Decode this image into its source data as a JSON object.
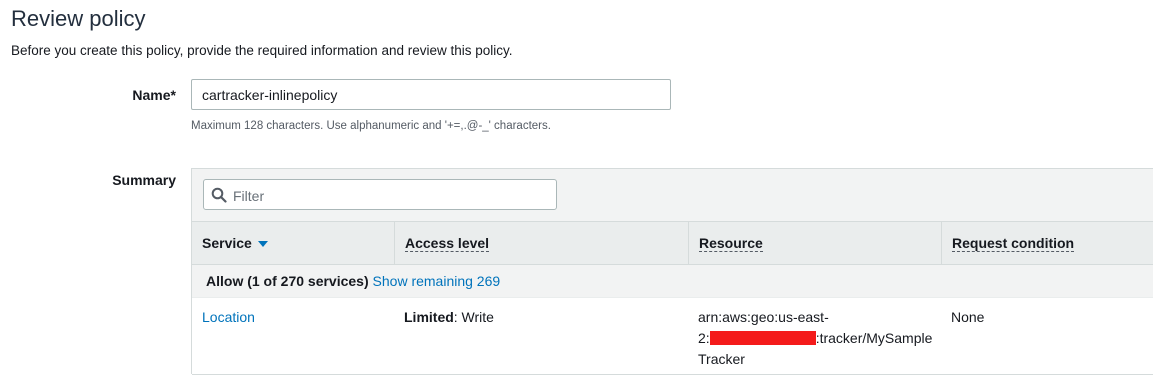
{
  "page": {
    "title": "Review policy",
    "description": "Before you create this policy, provide the required information and review this policy."
  },
  "form": {
    "name_label": "Name*",
    "name_value": "cartracker-inlinepolicy",
    "name_hint": "Maximum 128 characters. Use alphanumeric and '+=,.@-_' characters.",
    "summary_label": "Summary"
  },
  "summary": {
    "filter_placeholder": "Filter",
    "columns": [
      "Service",
      "Access level",
      "Resource",
      "Request condition"
    ],
    "group": {
      "label": "Allow (1 of 270 services)",
      "link": "Show remaining 269"
    },
    "rows": [
      {
        "service": "Location",
        "access_strong": "Limited",
        "access_rest": ": Write",
        "resource_line1": "arn:aws:geo:us-east-",
        "resource_prefix": "2:",
        "resource_suffix": ":tracker/MySample",
        "resource_line3": "Tracker",
        "condition": "None"
      }
    ]
  },
  "colors": {
    "link": "#0073bb",
    "header_bg": "#eaeded",
    "redaction": "#f41b1b"
  }
}
